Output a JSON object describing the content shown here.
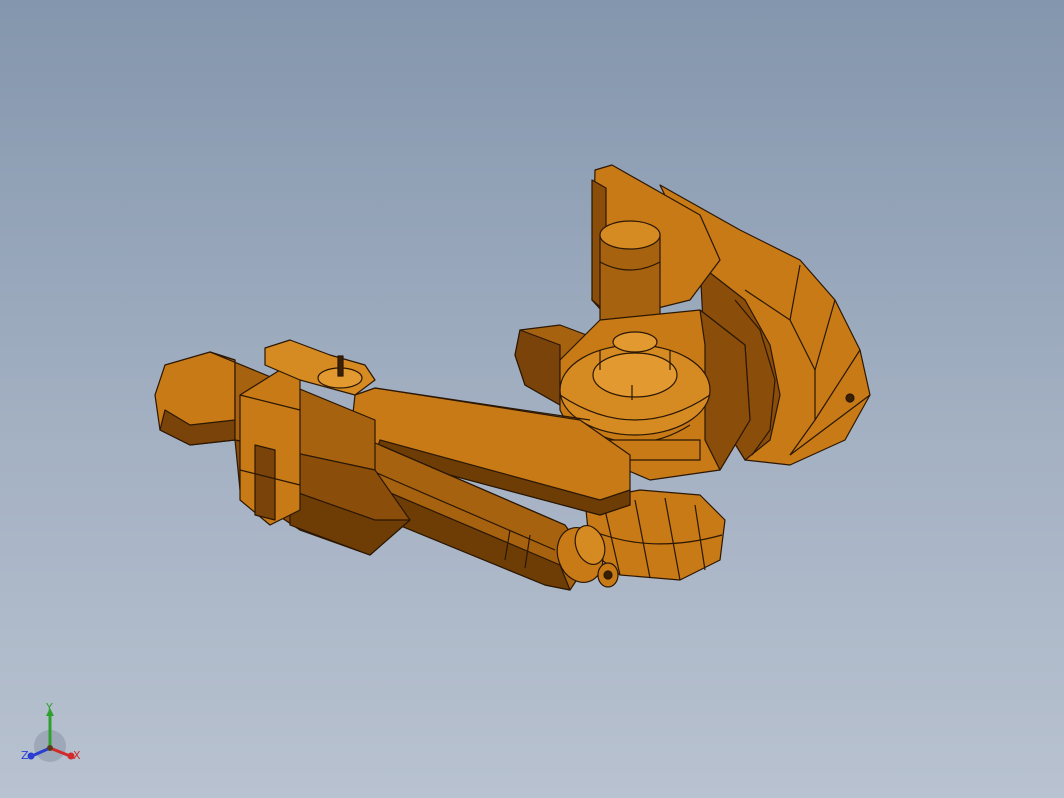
{
  "viewport": {
    "background_top": "#8496ad",
    "background_bottom": "#b8c2d0",
    "model": {
      "name": "robot-arm-assembly",
      "body_color": "#c77a16",
      "shadow_color": "#6e3d06",
      "edge_color": "#2b1703"
    }
  },
  "triad": {
    "x_label": "X",
    "y_label": "Y",
    "z_label": "Z",
    "x_color": "#d12a2a",
    "y_color": "#2ea02e",
    "z_color": "#2a3fd1"
  }
}
